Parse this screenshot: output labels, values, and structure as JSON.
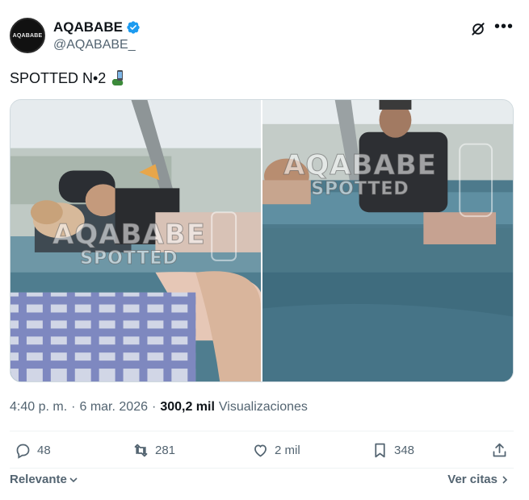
{
  "author": {
    "avatar_text": "AQABABE",
    "display_name": "AQABABE",
    "handle": "@AQABABE_",
    "verified": true
  },
  "post": {
    "text": "SPOTTED N•2",
    "emoji_icon": "mobile-phone-icon"
  },
  "media": {
    "watermark_title": "AQABABE",
    "watermark_sub": "SPOTTED",
    "photo_count": 2
  },
  "meta": {
    "time": "4:40 p. m.",
    "separator": "·",
    "date": "6 mar. 2026",
    "views_count": "300,2 mil",
    "views_label": "Visualizaciones"
  },
  "actions": {
    "replies": "48",
    "reposts": "281",
    "likes": "2 mil",
    "bookmarks": "348"
  },
  "footer": {
    "sort_label": "Relevante",
    "quotes_label": "Ver citas"
  },
  "colors": {
    "verified": "#1d9bf0",
    "secondary_text": "#536471",
    "primary_text": "#0f1419"
  }
}
